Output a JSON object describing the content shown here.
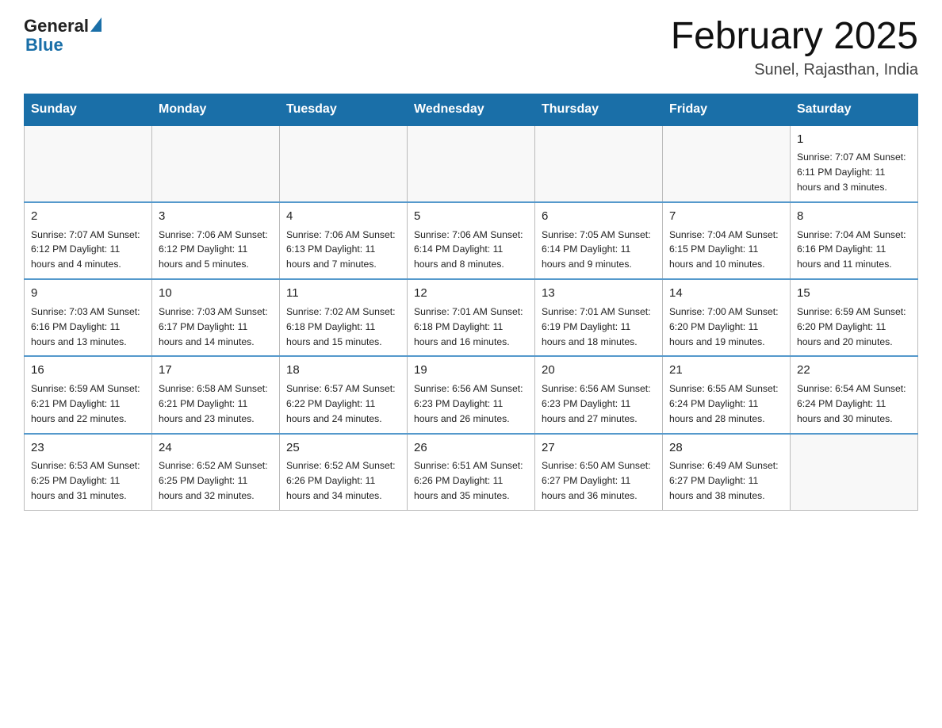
{
  "header": {
    "logo_general": "General",
    "logo_blue": "Blue",
    "month_title": "February 2025",
    "subtitle": "Sunel, Rajasthan, India"
  },
  "days_of_week": [
    "Sunday",
    "Monday",
    "Tuesday",
    "Wednesday",
    "Thursday",
    "Friday",
    "Saturday"
  ],
  "weeks": [
    [
      {
        "day": "",
        "info": ""
      },
      {
        "day": "",
        "info": ""
      },
      {
        "day": "",
        "info": ""
      },
      {
        "day": "",
        "info": ""
      },
      {
        "day": "",
        "info": ""
      },
      {
        "day": "",
        "info": ""
      },
      {
        "day": "1",
        "info": "Sunrise: 7:07 AM\nSunset: 6:11 PM\nDaylight: 11 hours and 3 minutes."
      }
    ],
    [
      {
        "day": "2",
        "info": "Sunrise: 7:07 AM\nSunset: 6:12 PM\nDaylight: 11 hours and 4 minutes."
      },
      {
        "day": "3",
        "info": "Sunrise: 7:06 AM\nSunset: 6:12 PM\nDaylight: 11 hours and 5 minutes."
      },
      {
        "day": "4",
        "info": "Sunrise: 7:06 AM\nSunset: 6:13 PM\nDaylight: 11 hours and 7 minutes."
      },
      {
        "day": "5",
        "info": "Sunrise: 7:06 AM\nSunset: 6:14 PM\nDaylight: 11 hours and 8 minutes."
      },
      {
        "day": "6",
        "info": "Sunrise: 7:05 AM\nSunset: 6:14 PM\nDaylight: 11 hours and 9 minutes."
      },
      {
        "day": "7",
        "info": "Sunrise: 7:04 AM\nSunset: 6:15 PM\nDaylight: 11 hours and 10 minutes."
      },
      {
        "day": "8",
        "info": "Sunrise: 7:04 AM\nSunset: 6:16 PM\nDaylight: 11 hours and 11 minutes."
      }
    ],
    [
      {
        "day": "9",
        "info": "Sunrise: 7:03 AM\nSunset: 6:16 PM\nDaylight: 11 hours and 13 minutes."
      },
      {
        "day": "10",
        "info": "Sunrise: 7:03 AM\nSunset: 6:17 PM\nDaylight: 11 hours and 14 minutes."
      },
      {
        "day": "11",
        "info": "Sunrise: 7:02 AM\nSunset: 6:18 PM\nDaylight: 11 hours and 15 minutes."
      },
      {
        "day": "12",
        "info": "Sunrise: 7:01 AM\nSunset: 6:18 PM\nDaylight: 11 hours and 16 minutes."
      },
      {
        "day": "13",
        "info": "Sunrise: 7:01 AM\nSunset: 6:19 PM\nDaylight: 11 hours and 18 minutes."
      },
      {
        "day": "14",
        "info": "Sunrise: 7:00 AM\nSunset: 6:20 PM\nDaylight: 11 hours and 19 minutes."
      },
      {
        "day": "15",
        "info": "Sunrise: 6:59 AM\nSunset: 6:20 PM\nDaylight: 11 hours and 20 minutes."
      }
    ],
    [
      {
        "day": "16",
        "info": "Sunrise: 6:59 AM\nSunset: 6:21 PM\nDaylight: 11 hours and 22 minutes."
      },
      {
        "day": "17",
        "info": "Sunrise: 6:58 AM\nSunset: 6:21 PM\nDaylight: 11 hours and 23 minutes."
      },
      {
        "day": "18",
        "info": "Sunrise: 6:57 AM\nSunset: 6:22 PM\nDaylight: 11 hours and 24 minutes."
      },
      {
        "day": "19",
        "info": "Sunrise: 6:56 AM\nSunset: 6:23 PM\nDaylight: 11 hours and 26 minutes."
      },
      {
        "day": "20",
        "info": "Sunrise: 6:56 AM\nSunset: 6:23 PM\nDaylight: 11 hours and 27 minutes."
      },
      {
        "day": "21",
        "info": "Sunrise: 6:55 AM\nSunset: 6:24 PM\nDaylight: 11 hours and 28 minutes."
      },
      {
        "day": "22",
        "info": "Sunrise: 6:54 AM\nSunset: 6:24 PM\nDaylight: 11 hours and 30 minutes."
      }
    ],
    [
      {
        "day": "23",
        "info": "Sunrise: 6:53 AM\nSunset: 6:25 PM\nDaylight: 11 hours and 31 minutes."
      },
      {
        "day": "24",
        "info": "Sunrise: 6:52 AM\nSunset: 6:25 PM\nDaylight: 11 hours and 32 minutes."
      },
      {
        "day": "25",
        "info": "Sunrise: 6:52 AM\nSunset: 6:26 PM\nDaylight: 11 hours and 34 minutes."
      },
      {
        "day": "26",
        "info": "Sunrise: 6:51 AM\nSunset: 6:26 PM\nDaylight: 11 hours and 35 minutes."
      },
      {
        "day": "27",
        "info": "Sunrise: 6:50 AM\nSunset: 6:27 PM\nDaylight: 11 hours and 36 minutes."
      },
      {
        "day": "28",
        "info": "Sunrise: 6:49 AM\nSunset: 6:27 PM\nDaylight: 11 hours and 38 minutes."
      },
      {
        "day": "",
        "info": ""
      }
    ]
  ]
}
